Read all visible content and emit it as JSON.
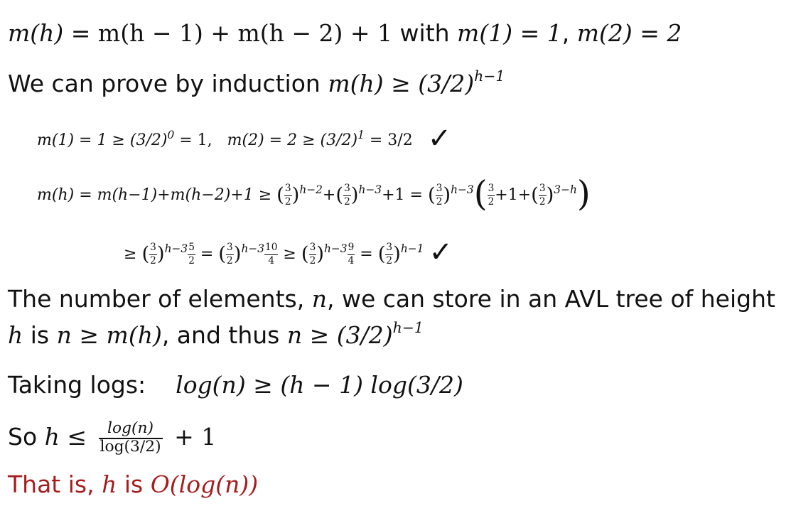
{
  "lines": {
    "l1_text": "with",
    "l1_sep": ",",
    "l2_text": "We can prove by induction",
    "l5_a": "The number of elements,",
    "l5_b": ", we can store in an AVL tree of height",
    "l6_a": "is",
    "l6_b": ", and thus",
    "l7_text": "Taking logs:",
    "l8_text": "So",
    "l9_a": "That is,",
    "l9_b": "is"
  },
  "math": {
    "m_of_h": "m(h)",
    "eq1_rhs": " = m(h − 1) + m(h − 2) + 1",
    "m1": "m(1) = 1",
    "m2": "m(2) = 2",
    "ind_lhs": "m(h) ≥ (3/2)",
    "ind_exp": "h−1",
    "base_a": "m(1) = 1 ≥ (3/2)",
    "base_a_exp": "0",
    "base_a_tail": " = 1,",
    "base_b": "m(2) = 2 ≥ (3/2)",
    "base_b_exp": "1",
    "base_b_tail": " = 3/2",
    "check": "✓",
    "step_lhs": "m(h) = m(h−1)+m(h−2)+1 ≥",
    "exp_h2": "h−2",
    "exp_h3": "h−3",
    "exp_3h": "3−h",
    "exp_h1": "h−1",
    "plus": "+",
    "plus1": "+1 =",
    "geq": "≥",
    "eq": "=",
    "three": "3",
    "two": "2",
    "five": "5",
    "ten": "10",
    "four": "4",
    "nine": "9",
    "one_plus": "+1+",
    "n": "n",
    "h": "h",
    "n_geq_mh": "n ≥ m(h)",
    "n_geq_pow": "n ≥ (3/2)",
    "logs": "log(n) ≥ (h − 1) log(3/2)",
    "h_leq": "h ≤",
    "frac_num": "log(n)",
    "frac_den": "log(3/2)",
    "plus_one": "+ 1",
    "big_o": "O(log(n))"
  }
}
